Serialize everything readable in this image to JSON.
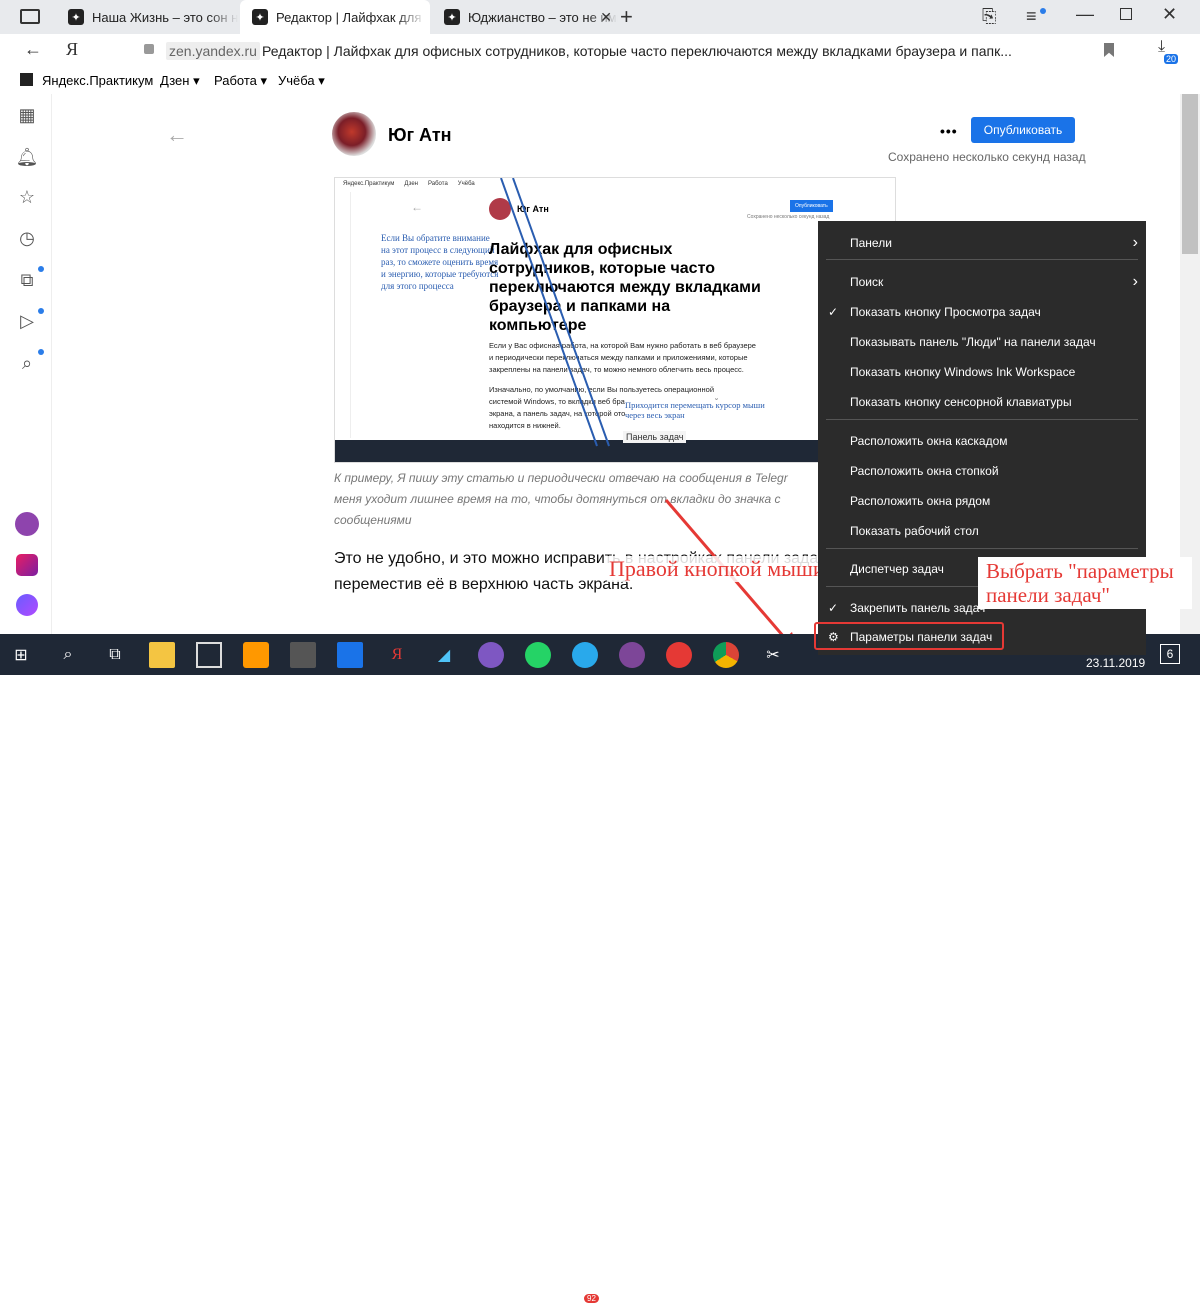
{
  "tabs": [
    {
      "title": "Наша Жизнь – это сон нер",
      "icon": "zen-icon"
    },
    {
      "title": "Редактор | Лайфхак для",
      "icon": "zen-icon",
      "active": true
    },
    {
      "title": "Юджианство – это не имп",
      "icon": "zen-icon"
    }
  ],
  "address": {
    "domain": "zen.yandex.ru",
    "title": "Редактор | Лайфхак для офисных сотрудников, которые часто переключаются между вкладками браузера и папк...",
    "downloads_badge": "20"
  },
  "bookmarks": [
    "Яндекс.Практикум",
    "Дзен",
    "Работа",
    "Учёба"
  ],
  "author": {
    "name": "Юг Атн"
  },
  "editor": {
    "publish_label": "Опубликовать",
    "saved_text": "Сохранено несколько секунд назад",
    "more": "•••"
  },
  "inner": {
    "bookmarks": [
      "Яндекс.Практикум",
      "Дзен",
      "Работа",
      "Учёба"
    ],
    "author": "Юг Атн",
    "publish": "Опубликовать",
    "saved": "Сохранено несколько секунд назад",
    "title": "Лайфхак для офисных сотрудников, которые часто переключаются между вкладками браузера и папками на компьютере",
    "para1": "Если у Вас офисная работа, на которой Вам нужно работать в веб браузере и периодически переключаться между папками и приложениями, которые закреплены на панели задач, то можно немного облегчить весь процесс.",
    "para2": "Изначально, по умолчанию, если Вы пользуетесь операционной системой Windows, то вкладки веб браузера находятся в верхней части экрана, а панель задач, на которой отображаются значки программ находится в нижней.",
    "note_blue": "Если Вы обратите внимание на этот процесс в следующий раз, то сможете оценить время и энергию, которые требуются для этого процесса",
    "note_blue2": "Приходится перемещать курсор мыши через весь экран",
    "taskbar_label": "Панель задач"
  },
  "caption": "К примеру, Я пишу эту статью и периодически отвечаю на сообщения в Telegr меня уходит лишнее время на то, чтобы дотянуться от вкладки до значка с сообщениями",
  "body_text": "Это не удобно, и это можно исправить в настройках панели задач переместив её в верхнюю часть экрана.",
  "menu": {
    "items": [
      {
        "label": "Панели",
        "arrow": true,
        "check": false
      },
      {
        "label": "Поиск",
        "arrow": true,
        "check": false
      },
      {
        "label": "Показать кнопку Просмотра задач",
        "arrow": false,
        "check": true
      },
      {
        "label": "Показывать панель \"Люди\" на панели задач",
        "arrow": false,
        "check": false
      },
      {
        "label": "Показать кнопку Windows Ink Workspace",
        "arrow": false,
        "check": false
      },
      {
        "label": "Показать кнопку сенсорной клавиатуры",
        "arrow": false,
        "check": false
      },
      {
        "label": "Расположить окна каскадом",
        "arrow": false,
        "check": false
      },
      {
        "label": "Расположить окна стопкой",
        "arrow": false,
        "check": false
      },
      {
        "label": "Расположить окна рядом",
        "arrow": false,
        "check": false
      },
      {
        "label": "Показать рабочий стол",
        "arrow": false,
        "check": false
      },
      {
        "label": "Диспетчер задач",
        "arrow": false,
        "check": false
      },
      {
        "label": "Закрепить панель задач",
        "arrow": false,
        "check": true
      },
      {
        "label": "Параметры панели задач",
        "arrow": false,
        "check": false,
        "gear": true
      }
    ]
  },
  "annotations": {
    "right_click": "Правой кнопкой мыши",
    "choose": "Выбрать \"параметры панели задач\""
  },
  "taskbar": {
    "date": "23.11.2019",
    "notif_count": "6",
    "telegram_badge": "92"
  },
  "colors": {
    "accent": "#1a73e8",
    "publish": "#1a73e8",
    "annotation": "#e53935",
    "taskbar": "#1f2836",
    "menu": "#2b2b2b"
  }
}
